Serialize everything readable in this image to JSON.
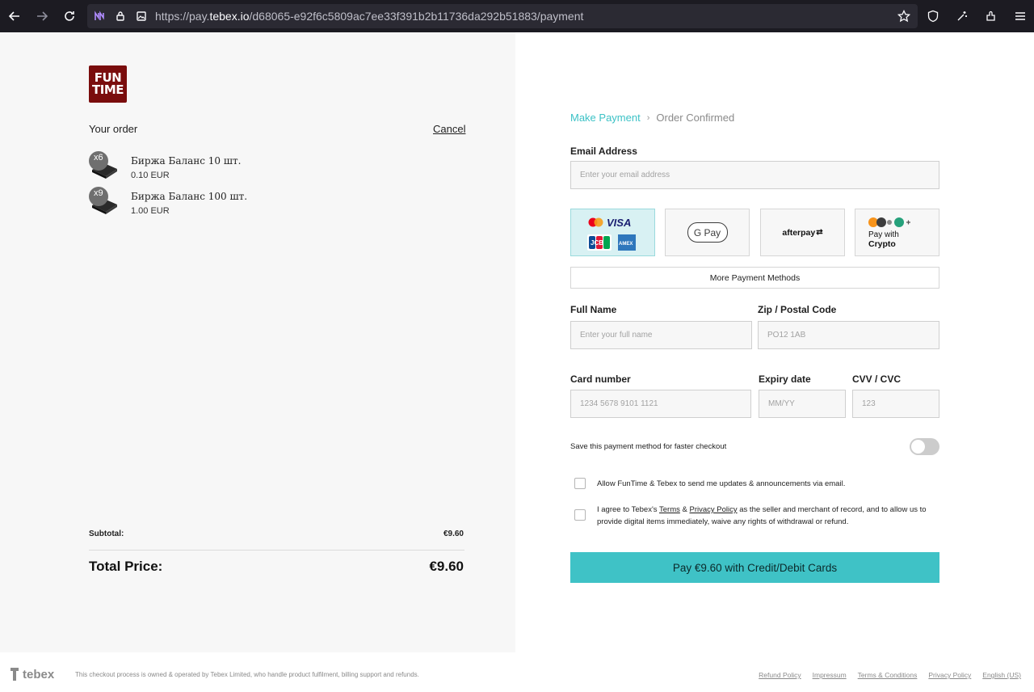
{
  "browser": {
    "url_prefix": "https://pay.",
    "url_host": "tebex.io",
    "url_path": "/d68065-e92f6c5809ac7ee33f391b2b11736da292b51883/payment"
  },
  "store": {
    "logo_line1": "FUN",
    "logo_line2": "TIME"
  },
  "order": {
    "heading": "Your order",
    "cancel_label": "Cancel",
    "items": [
      {
        "qty": "x6",
        "name": "Биржа Баланс 10 шт.",
        "price": "0.10 EUR"
      },
      {
        "qty": "x9",
        "name": "Биржа Баланс 100 шт.",
        "price": "1.00 EUR"
      }
    ],
    "subtotal_label": "Subtotal:",
    "subtotal_value": "€9.60",
    "total_label": "Total Price:",
    "total_value": "€9.60"
  },
  "steps": {
    "current": "Make Payment",
    "next": "Order Confirmed"
  },
  "form": {
    "email_label": "Email Address",
    "email_placeholder": "Enter your email address",
    "payment_methods": {
      "card_brands": [
        "VISA",
        "JCB",
        "AMEX"
      ],
      "gpay": "G Pay",
      "afterpay": "afterpay",
      "crypto_line1": "Pay with",
      "crypto_line2": "Crypto"
    },
    "more_methods": "More Payment Methods",
    "fullname_label": "Full Name",
    "fullname_placeholder": "Enter your full name",
    "zip_label": "Zip / Postal Code",
    "zip_placeholder": "PO12 1AB",
    "card_label": "Card number",
    "card_placeholder": "1234 5678 9101 1121",
    "expiry_label": "Expiry date",
    "expiry_placeholder": "MM/YY",
    "cvv_label": "CVV / CVC",
    "cvv_placeholder": "123",
    "save_method": "Save this payment method for faster checkout",
    "consent_updates": "Allow FunTime & Tebex to send me updates & announcements via email.",
    "terms_pre": "I agree to Tebex's ",
    "terms_link": "Terms",
    "terms_amp": " & ",
    "privacy_link": "Privacy Policy",
    "terms_post": " as the seller and merchant of record, and to allow us to provide digital items immediately, waive any rights of withdrawal or refund.",
    "pay_button": "Pay €9.60 with Credit/Debit Cards"
  },
  "footer": {
    "brand": "tebex",
    "note": "This checkout process is owned & operated by Tebex Limited, who handle product fulfilment, billing support and refunds.",
    "links": [
      "Refund Policy",
      "Impressum",
      "Terms & Conditions",
      "Privacy Policy",
      "English (US)"
    ]
  },
  "colors": {
    "accent": "#3fc2c6",
    "logo_bg": "#7a0d0d",
    "panel_bg": "#f7f7f7"
  }
}
